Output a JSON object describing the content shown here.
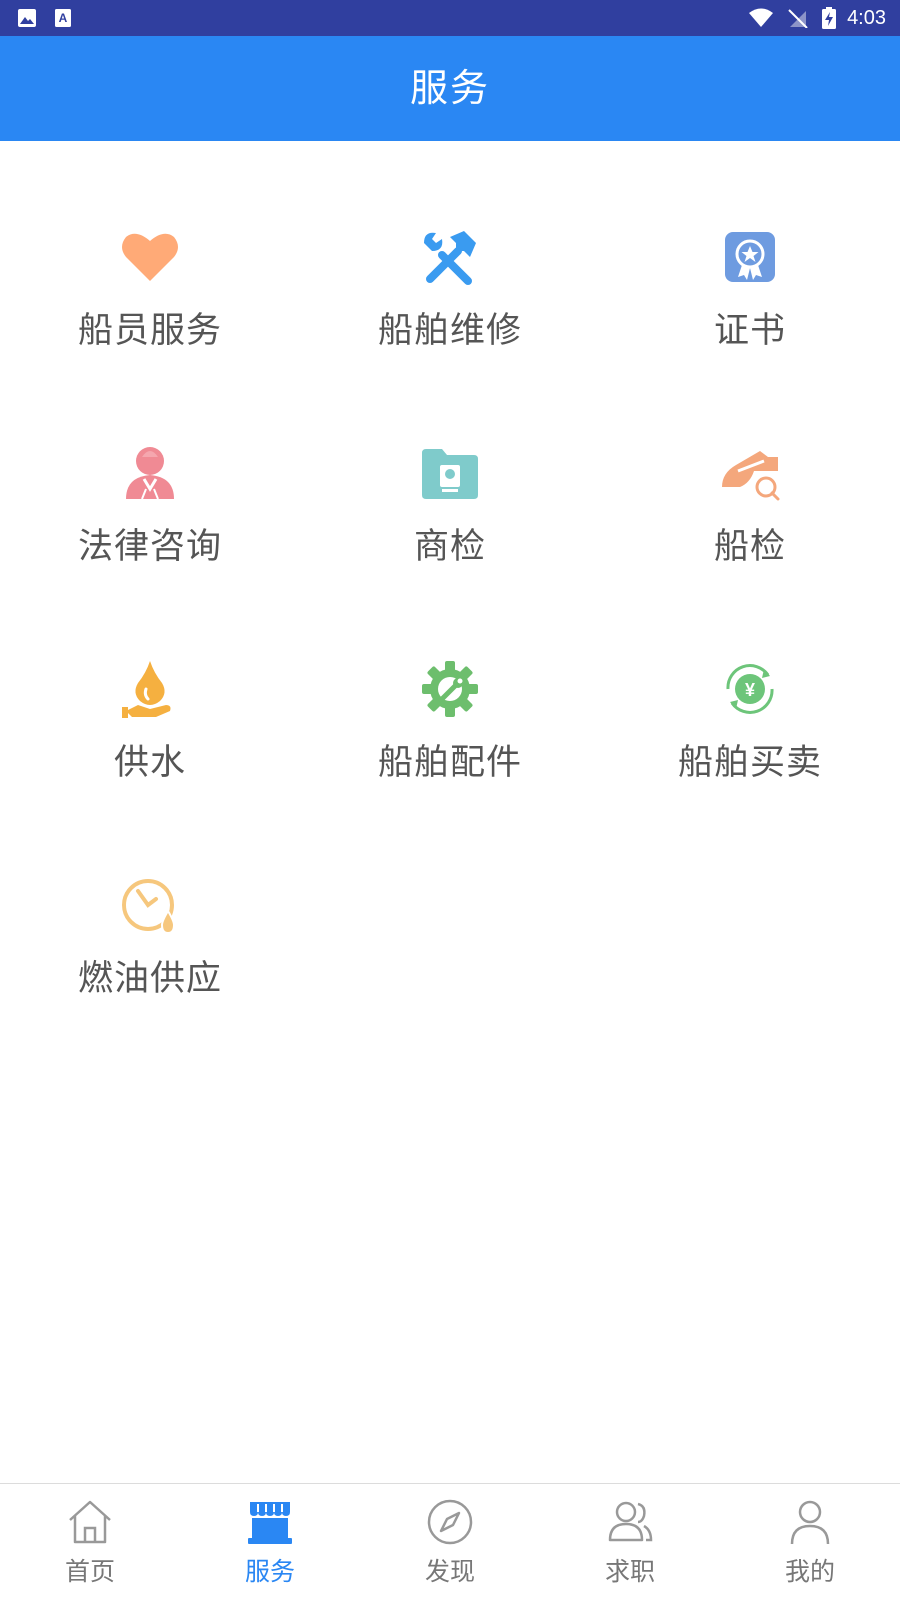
{
  "status_bar": {
    "time": "4:03",
    "background": "#303F9F",
    "left_icons": [
      "image-notification-icon",
      "text-notification-icon"
    ],
    "right_icons": [
      "wifi-icon",
      "no-sim-icon",
      "battery-charging-icon"
    ]
  },
  "app_bar": {
    "title": "服务",
    "background": "#2A87F3"
  },
  "services": [
    {
      "label": "船员服务",
      "icon": "heart-icon",
      "color": "#FFAA77"
    },
    {
      "label": "船舶维修",
      "icon": "tools-icon",
      "color": "#3A9BF0"
    },
    {
      "label": "证书",
      "icon": "certificate-icon",
      "color": "#6E9BE0"
    },
    {
      "label": "法律咨询",
      "icon": "lawyer-icon",
      "color": "#F08A94"
    },
    {
      "label": "商检",
      "icon": "folder-inspection-icon",
      "color": "#7FCBCB"
    },
    {
      "label": "船检",
      "icon": "ship-search-icon",
      "color": "#F4A77C"
    },
    {
      "label": "供水",
      "icon": "water-drop-hand-icon",
      "color": "#F5B040"
    },
    {
      "label": "船舶配件",
      "icon": "gear-wrench-icon",
      "color": "#6DBE6D"
    },
    {
      "label": "船舶买卖",
      "icon": "yuan-exchange-icon",
      "color": "#6DC57A"
    },
    {
      "label": "燃油供应",
      "icon": "clock-drop-icon",
      "color": "#F6C77D"
    }
  ],
  "tab_bar": {
    "active_color": "#2A87F3",
    "inactive_color": "#777777",
    "tabs": [
      {
        "label": "首页",
        "icon": "home-icon",
        "active": false
      },
      {
        "label": "服务",
        "icon": "store-icon",
        "active": true
      },
      {
        "label": "发现",
        "icon": "compass-icon",
        "active": false
      },
      {
        "label": "求职",
        "icon": "users-icon",
        "active": false
      },
      {
        "label": "我的",
        "icon": "person-icon",
        "active": false
      }
    ]
  }
}
